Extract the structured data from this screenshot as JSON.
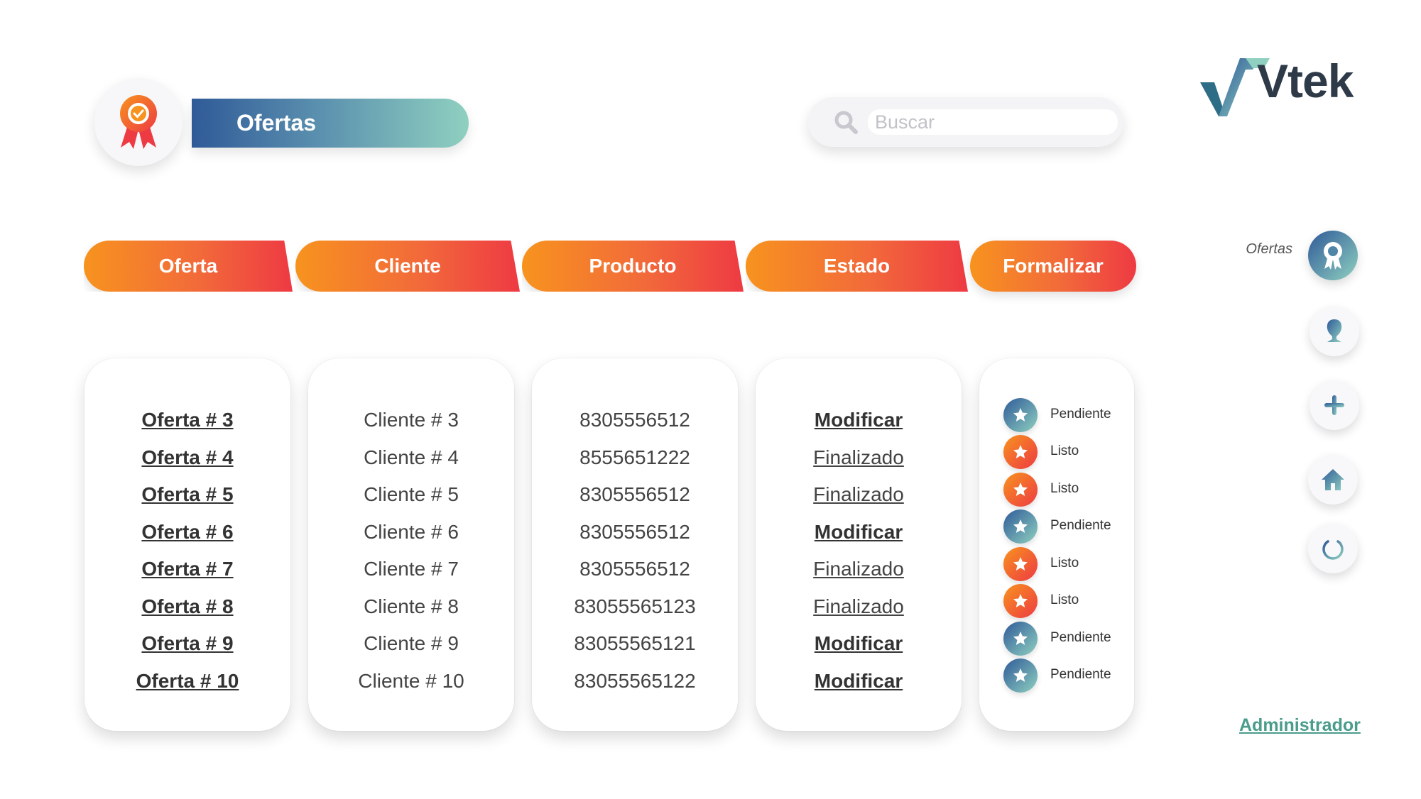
{
  "header": {
    "title": "Ofertas",
    "badge_icon": "award-ribbon-icon"
  },
  "search": {
    "placeholder": "Buscar",
    "value": ""
  },
  "logo": {
    "text": "Vtek"
  },
  "columns": {
    "oferta": "Oferta",
    "cliente": "Cliente",
    "producto": "Producto",
    "estado": "Estado",
    "formalizar": "Formalizar"
  },
  "rows": [
    {
      "oferta": "Oferta # 3",
      "cliente": "Cliente # 3",
      "producto": "8305556512",
      "estado": "Modificar",
      "formalizar": "Pendiente"
    },
    {
      "oferta": "Oferta # 4",
      "cliente": "Cliente # 4",
      "producto": "8555651222",
      "estado": "Finalizado",
      "formalizar": "Listo"
    },
    {
      "oferta": "Oferta # 5",
      "cliente": "Cliente # 5",
      "producto": "8305556512",
      "estado": "Finalizado",
      "formalizar": "Listo"
    },
    {
      "oferta": "Oferta # 6",
      "cliente": "Cliente # 6",
      "producto": "8305556512",
      "estado": "Modificar",
      "formalizar": "Pendiente"
    },
    {
      "oferta": "Oferta # 7",
      "cliente": "Cliente # 7",
      "producto": "8305556512",
      "estado": "Finalizado",
      "formalizar": "Listo"
    },
    {
      "oferta": "Oferta # 8",
      "cliente": "Cliente # 8",
      "producto": "83055565123",
      "estado": "Finalizado",
      "formalizar": "Listo"
    },
    {
      "oferta": "Oferta # 9",
      "cliente": "Cliente # 9",
      "producto": "83055565121",
      "estado": "Modificar",
      "formalizar": "Pendiente"
    },
    {
      "oferta": "Oferta # 10",
      "cliente": "Cliente # 10",
      "producto": "83055565122",
      "estado": "Modificar",
      "formalizar": "Pendiente"
    }
  ],
  "nav": {
    "active_label": "Ofertas",
    "items": [
      {
        "name": "ofertas",
        "icon": "award-ribbon-icon"
      },
      {
        "name": "clientes",
        "icon": "user-icon"
      },
      {
        "name": "add",
        "icon": "plus-icon"
      },
      {
        "name": "home",
        "icon": "home-icon"
      },
      {
        "name": "logout",
        "icon": "power-icon"
      }
    ]
  },
  "footer": {
    "admin_label": "Administrador"
  },
  "colors": {
    "orange_start": "#f7931e",
    "orange_end": "#ee3a43",
    "blue_start": "#2f5a98",
    "teal_end": "#8fd0c0",
    "admin_link": "#4a9c8c"
  }
}
